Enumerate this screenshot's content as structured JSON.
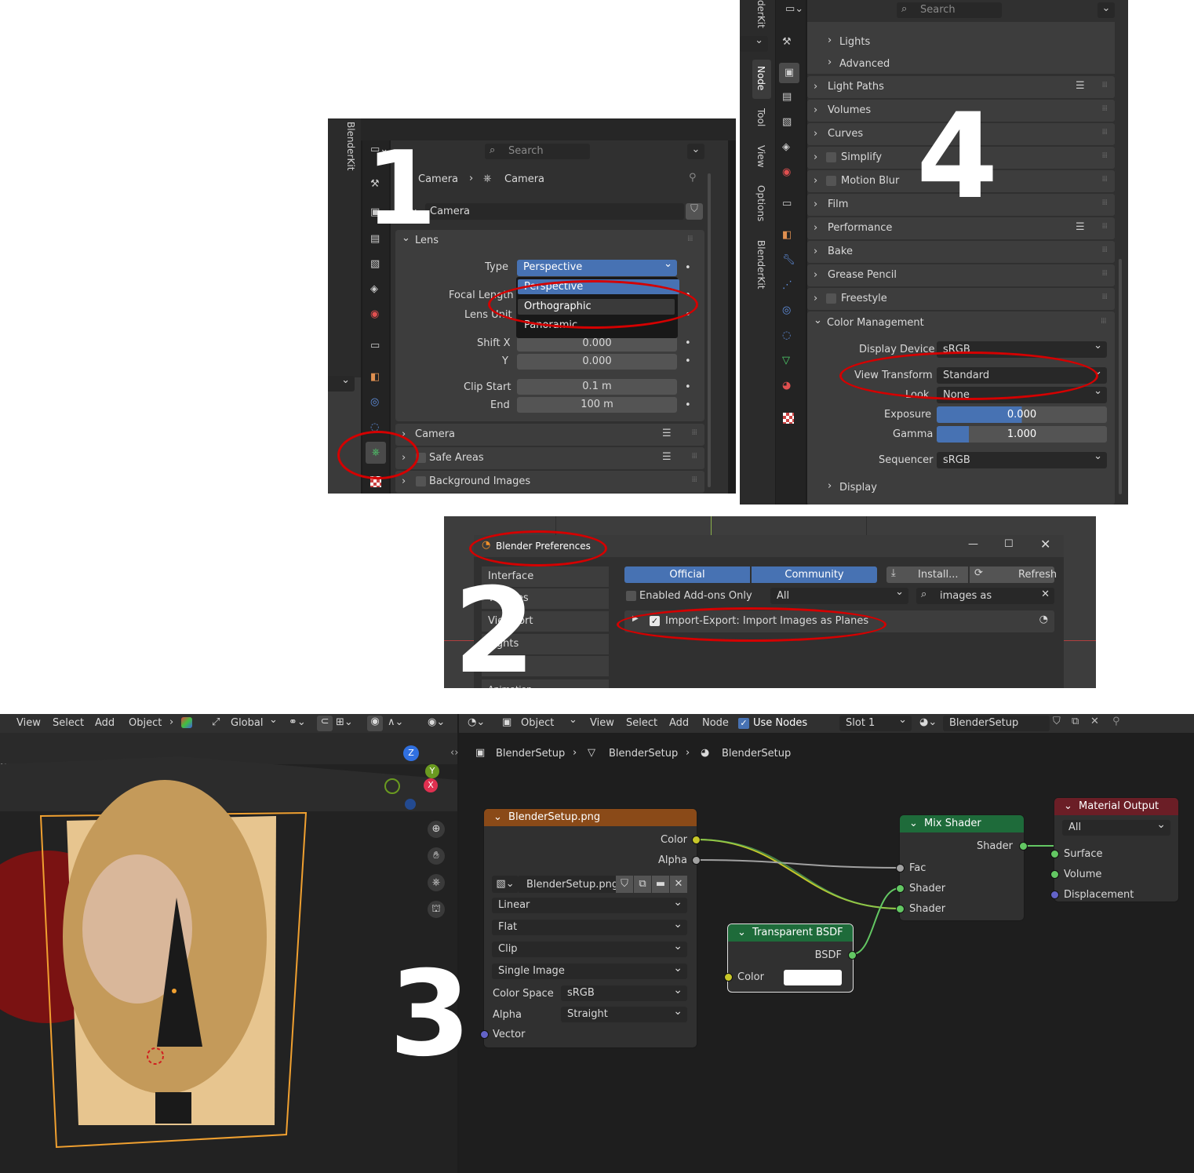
{
  "panel1": {
    "number": "1",
    "sidebar_tab": "BlenderKit",
    "search_placeholder": "Search",
    "breadcrumb": [
      "Camera",
      "Camera"
    ],
    "datablock": "Camera",
    "section_lens": "Lens",
    "type_label": "Type",
    "type_value": "Perspective",
    "dropdown_options": [
      "Perspective",
      "Orthographic",
      "Panoramic"
    ],
    "focal_length_label": "Focal Length",
    "lens_unit_label": "Lens Unit",
    "shift_x_label": "Shift X",
    "shift_x_value": "0.000",
    "shift_y_label": "Y",
    "shift_y_value": "0.000",
    "clip_start_label": "Clip Start",
    "clip_start_value": "0.1 m",
    "clip_end_label": "End",
    "clip_end_value": "100 m",
    "sections": [
      "Camera",
      "Safe Areas",
      "Background Images"
    ]
  },
  "panel4": {
    "number": "4",
    "search_placeholder": "Search",
    "vertical_tabs": [
      "derKit",
      "Node",
      "Tool",
      "View",
      "Options",
      "BlenderKit"
    ],
    "subsections": [
      "Lights",
      "Advanced"
    ],
    "sections": [
      "Light Paths",
      "Volumes",
      "Curves",
      "Simplify",
      "Motion Blur",
      "Film",
      "Performance",
      "Bake",
      "Grease Pencil",
      "Freestyle"
    ],
    "color_management": "Color Management",
    "display_device_label": "Display Device",
    "display_device_value": "sRGB",
    "view_transform_label": "View Transform",
    "view_transform_value": "Standard",
    "look_label": "Look",
    "look_value": "None",
    "exposure_label": "Exposure",
    "exposure_value": "0.000",
    "gamma_label": "Gamma",
    "gamma_value": "1.000",
    "sequencer_label": "Sequencer",
    "sequencer_value": "sRGB",
    "display_sub": "Display"
  },
  "panel2": {
    "number": "2",
    "window_title": "Blender Preferences",
    "tabs": [
      "Official",
      "Community"
    ],
    "install_label": "Install...",
    "refresh_label": "Refresh",
    "enabled_only_label": "Enabled Add-ons Only",
    "category_value": "All",
    "search_value": "images as",
    "addon_label": "Import-Export: Import Images as Planes",
    "sidebar": [
      "Interface",
      "Themes",
      "Viewport",
      "Lights",
      "Editing",
      "Animation"
    ]
  },
  "panel3": {
    "number": "3",
    "viewport_menu": [
      "View",
      "Select",
      "Add",
      "Object"
    ],
    "orientation": "Global",
    "viewport_label": "up",
    "node_menu": [
      "Object",
      "View",
      "Select",
      "Add",
      "Node"
    ],
    "use_nodes_label": "Use Nodes",
    "slot_label": "Slot 1",
    "material_name": "BlenderSetup",
    "breadcrumb": [
      "BlenderSetup",
      "BlenderSetup",
      "BlenderSetup"
    ],
    "image_node": {
      "title": "BlenderSetup.png",
      "out_color": "Color",
      "out_alpha": "Alpha",
      "image_name": "BlenderSetup.png",
      "interpolation": "Linear",
      "projection": "Flat",
      "extension": "Clip",
      "source": "Single Image",
      "color_space_label": "Color Space",
      "color_space_value": "sRGB",
      "alpha_label": "Alpha",
      "alpha_value": "Straight",
      "vector_label": "Vector"
    },
    "mix_node": {
      "title": "Mix Shader",
      "out": "Shader",
      "in_fac": "Fac",
      "in_shader1": "Shader",
      "in_shader2": "Shader"
    },
    "transparent_node": {
      "title": "Transparent BSDF",
      "out": "BSDF",
      "color_label": "Color"
    },
    "output_node": {
      "title": "Material Output",
      "target": "All",
      "surface": "Surface",
      "volume": "Volume",
      "displacement": "Displacement"
    },
    "gizmo_axes": [
      "Z",
      "Y",
      "X"
    ]
  }
}
